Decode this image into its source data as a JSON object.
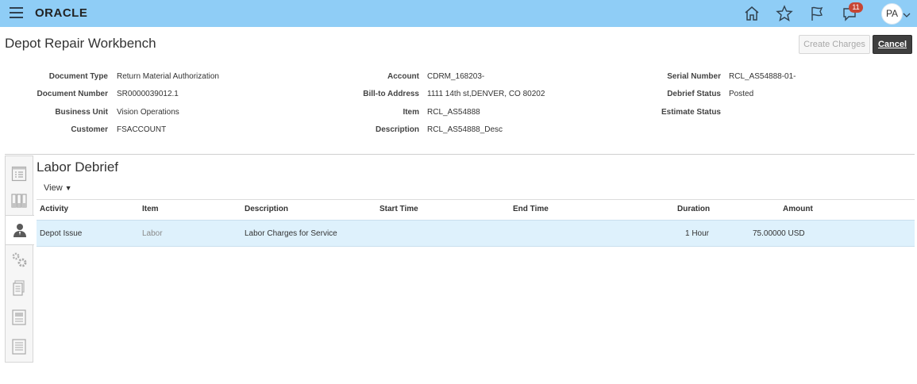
{
  "app": {
    "logo": "ORACLE",
    "notifications_count": "11",
    "user_initials": "PA"
  },
  "icons": {
    "menu": "hamburger-menu-icon",
    "home": "home-icon",
    "favorites": "star-icon",
    "watchlist": "flag-icon",
    "notifications": "notification-bell-icon",
    "user_menu": "chevron-down-icon"
  },
  "page": {
    "title": "Depot Repair Workbench",
    "create_charges_label": "Create Charges",
    "cancel_label": "Cancel"
  },
  "details": {
    "col1": [
      {
        "label": "Document Type",
        "value": "Return Material Authorization"
      },
      {
        "label": "Document Number",
        "value": "SR0000039012.1"
      },
      {
        "label": "Business Unit",
        "value": "Vision Operations"
      },
      {
        "label": "Customer",
        "value": "FSACCOUNT"
      }
    ],
    "col2": [
      {
        "label": "Account",
        "value": "CDRM_168203-"
      },
      {
        "label": "Bill-to Address",
        "value": "1111 14th st,DENVER, CO 80202"
      },
      {
        "label": "Item",
        "value": "RCL_AS54888"
      },
      {
        "label": "Description",
        "value": "RCL_AS54888_Desc"
      }
    ],
    "col3": [
      {
        "label": "Serial Number",
        "value": "RCL_AS54888-01-"
      },
      {
        "label": "Debrief Status",
        "value": "Posted"
      },
      {
        "label": "Estimate Status",
        "value": ""
      }
    ]
  },
  "rail": {
    "items": [
      "list-view-icon",
      "columns-icon",
      "person-labor-icon",
      "gears-icon",
      "documents-icon",
      "form-icon",
      "notes-icon"
    ],
    "active": "person-labor-icon"
  },
  "labor_debrief": {
    "title": "Labor Debrief",
    "view_menu_label": "View",
    "columns": [
      "Activity",
      "Item",
      "Description",
      "Start Time",
      "End Time",
      "Duration",
      "Amount"
    ],
    "rows": [
      {
        "activity": "Depot Issue",
        "item": "Labor",
        "description": "Labor Charges for Service",
        "start_time": "",
        "end_time": "",
        "duration": "1 Hour",
        "amount": "75.00000 USD"
      }
    ]
  },
  "colors": {
    "topbar": "#8fcdf6",
    "cancel_button": "#3f3f3f",
    "selected_row": "#def1fc",
    "badge": "#c74634"
  }
}
